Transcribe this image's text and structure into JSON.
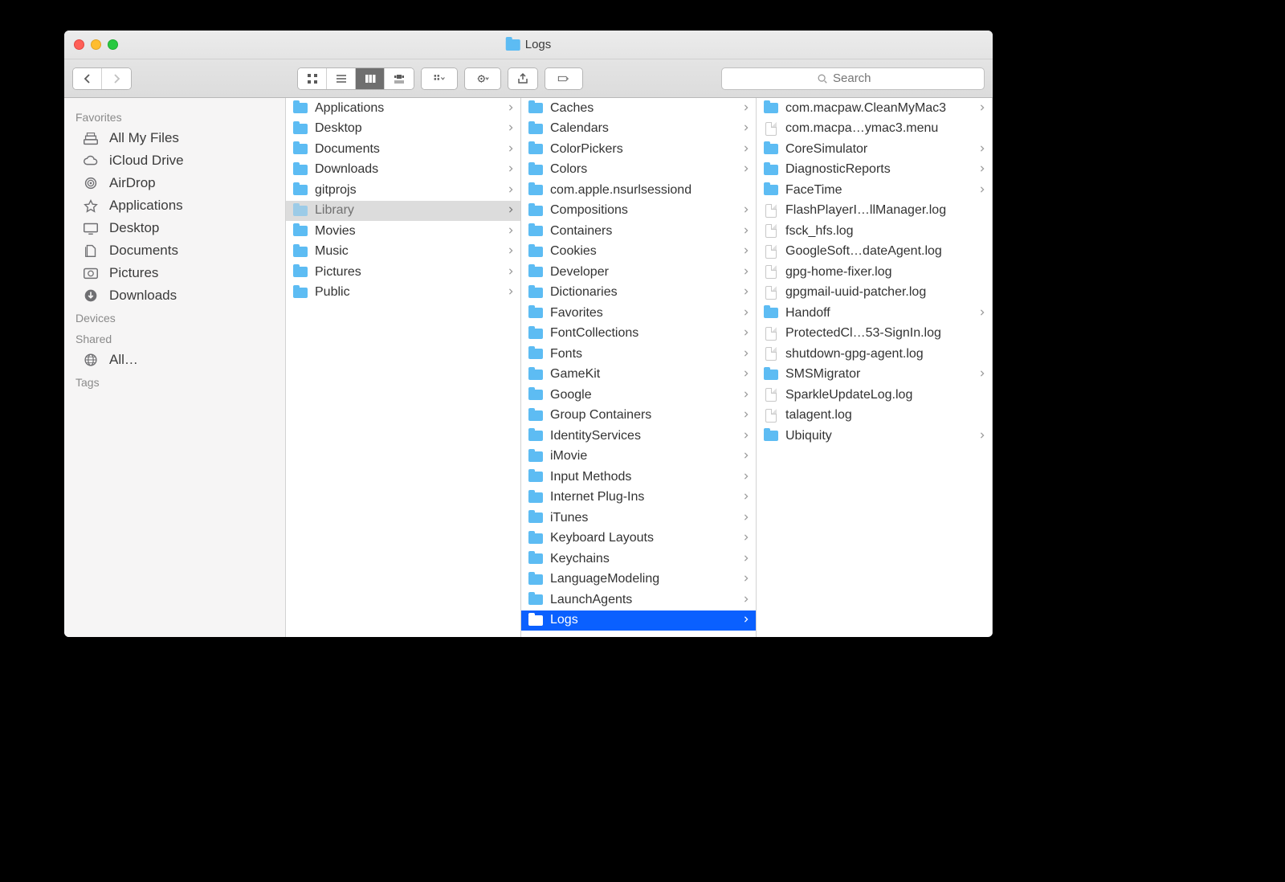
{
  "window": {
    "title": "Logs"
  },
  "search": {
    "placeholder": "Search"
  },
  "sidebar": {
    "sections": [
      {
        "header": "Favorites",
        "items": [
          {
            "icon": "all-my-files-icon",
            "label": "All My Files"
          },
          {
            "icon": "icloud-icon",
            "label": "iCloud Drive"
          },
          {
            "icon": "airdrop-icon",
            "label": "AirDrop"
          },
          {
            "icon": "applications-icon",
            "label": "Applications"
          },
          {
            "icon": "desktop-icon",
            "label": "Desktop"
          },
          {
            "icon": "documents-icon",
            "label": "Documents"
          },
          {
            "icon": "pictures-icon",
            "label": "Pictures"
          },
          {
            "icon": "downloads-icon",
            "label": "Downloads"
          }
        ]
      },
      {
        "header": "Devices",
        "items": []
      },
      {
        "header": "Shared",
        "items": [
          {
            "icon": "network-icon",
            "label": "All…"
          }
        ]
      },
      {
        "header": "Tags",
        "items": []
      }
    ]
  },
  "columns": [
    {
      "items": [
        {
          "type": "folder",
          "label": "Applications",
          "hasChildren": true
        },
        {
          "type": "folder",
          "label": "Desktop",
          "hasChildren": true
        },
        {
          "type": "folder",
          "label": "Documents",
          "hasChildren": true
        },
        {
          "type": "folder",
          "label": "Downloads",
          "hasChildren": true
        },
        {
          "type": "folder",
          "label": "gitprojs",
          "hasChildren": true
        },
        {
          "type": "folder",
          "label": "Library",
          "hasChildren": true,
          "selection": "dim"
        },
        {
          "type": "folder",
          "label": "Movies",
          "hasChildren": true
        },
        {
          "type": "folder",
          "label": "Music",
          "hasChildren": true
        },
        {
          "type": "folder",
          "label": "Pictures",
          "hasChildren": true
        },
        {
          "type": "folder",
          "label": "Public",
          "hasChildren": true
        }
      ]
    },
    {
      "items": [
        {
          "type": "folder",
          "label": "Caches",
          "hasChildren": true
        },
        {
          "type": "folder",
          "label": "Calendars",
          "hasChildren": true
        },
        {
          "type": "folder",
          "label": "ColorPickers",
          "hasChildren": true
        },
        {
          "type": "folder",
          "label": "Colors",
          "hasChildren": true
        },
        {
          "type": "folder",
          "label": "com.apple.nsurlsessiond",
          "hasChildren": false
        },
        {
          "type": "folder",
          "label": "Compositions",
          "hasChildren": true
        },
        {
          "type": "folder",
          "label": "Containers",
          "hasChildren": true
        },
        {
          "type": "folder",
          "label": "Cookies",
          "hasChildren": true
        },
        {
          "type": "folder",
          "label": "Developer",
          "hasChildren": true
        },
        {
          "type": "folder",
          "label": "Dictionaries",
          "hasChildren": true
        },
        {
          "type": "folder",
          "label": "Favorites",
          "hasChildren": true
        },
        {
          "type": "folder",
          "label": "FontCollections",
          "hasChildren": true
        },
        {
          "type": "folder",
          "label": "Fonts",
          "hasChildren": true
        },
        {
          "type": "folder",
          "label": "GameKit",
          "hasChildren": true
        },
        {
          "type": "folder",
          "label": "Google",
          "hasChildren": true
        },
        {
          "type": "folder",
          "label": "Group Containers",
          "hasChildren": true
        },
        {
          "type": "folder",
          "label": "IdentityServices",
          "hasChildren": true
        },
        {
          "type": "folder",
          "label": "iMovie",
          "hasChildren": true
        },
        {
          "type": "folder",
          "label": "Input Methods",
          "hasChildren": true
        },
        {
          "type": "folder",
          "label": "Internet Plug-Ins",
          "hasChildren": true
        },
        {
          "type": "folder",
          "label": "iTunes",
          "hasChildren": true
        },
        {
          "type": "folder",
          "label": "Keyboard Layouts",
          "hasChildren": true
        },
        {
          "type": "folder",
          "label": "Keychains",
          "hasChildren": true
        },
        {
          "type": "folder",
          "label": "LanguageModeling",
          "hasChildren": true
        },
        {
          "type": "folder",
          "label": "LaunchAgents",
          "hasChildren": true
        },
        {
          "type": "folder",
          "label": "Logs",
          "hasChildren": true,
          "selection": "active"
        }
      ]
    },
    {
      "items": [
        {
          "type": "folder",
          "label": "com.macpaw.CleanMyMac3",
          "hasChildren": true
        },
        {
          "type": "file",
          "label": "com.macpa…ymac3.menu",
          "hasChildren": false
        },
        {
          "type": "folder",
          "label": "CoreSimulator",
          "hasChildren": true
        },
        {
          "type": "folder",
          "label": "DiagnosticReports",
          "hasChildren": true
        },
        {
          "type": "folder",
          "label": "FaceTime",
          "hasChildren": true
        },
        {
          "type": "file",
          "label": "FlashPlayerI…llManager.log",
          "hasChildren": false
        },
        {
          "type": "file",
          "label": "fsck_hfs.log",
          "hasChildren": false
        },
        {
          "type": "file",
          "label": "GoogleSoft…dateAgent.log",
          "hasChildren": false
        },
        {
          "type": "file",
          "label": "gpg-home-fixer.log",
          "hasChildren": false
        },
        {
          "type": "file",
          "label": "gpgmail-uuid-patcher.log",
          "hasChildren": false
        },
        {
          "type": "folder",
          "label": "Handoff",
          "hasChildren": true
        },
        {
          "type": "file",
          "label": "ProtectedCl…53-SignIn.log",
          "hasChildren": false
        },
        {
          "type": "file",
          "label": "shutdown-gpg-agent.log",
          "hasChildren": false
        },
        {
          "type": "folder",
          "label": "SMSMigrator",
          "hasChildren": true
        },
        {
          "type": "file",
          "label": "SparkleUpdateLog.log",
          "hasChildren": false
        },
        {
          "type": "file",
          "label": "talagent.log",
          "hasChildren": false
        },
        {
          "type": "folder",
          "label": "Ubiquity",
          "hasChildren": true
        }
      ]
    }
  ]
}
